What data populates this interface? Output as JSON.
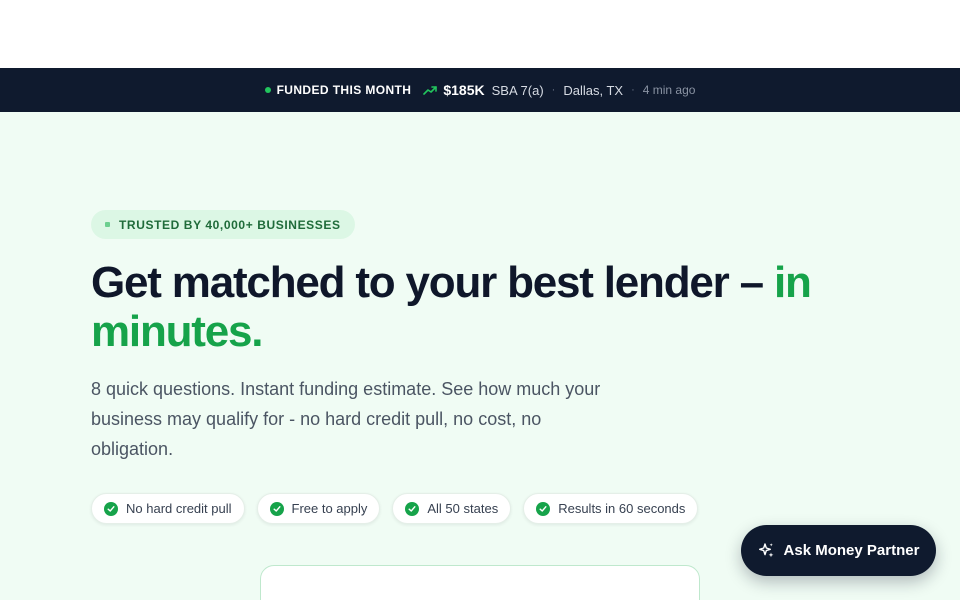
{
  "ticker": {
    "label": "FUNDED THIS MONTH",
    "amount": "$185K",
    "program": "SBA 7(a)",
    "separator": "·",
    "city": "Dallas, TX",
    "time_ago": "4 min ago",
    "accent_color": "#22c55e"
  },
  "hero": {
    "badge": "TRUSTED BY 40,000+ BUSINESSES",
    "headline_main": "Get matched to your best lender – ",
    "headline_accent": "in minutes",
    "headline_end": ".",
    "subtext": "8 quick questions. Instant funding estimate. See how much your business may qualify for - no hard credit pull, no cost, no obligation.",
    "chips": [
      "No hard credit pull",
      "Free to apply",
      "All 50 states",
      "Results in 60 seconds"
    ]
  },
  "assistant": {
    "button_label": "Ask Money Partner",
    "icon": "sparkles-icon"
  },
  "colors": {
    "brand_green": "#16a34a",
    "navy": "#0f1a2e",
    "hero_bg": "#f0fcf4"
  }
}
